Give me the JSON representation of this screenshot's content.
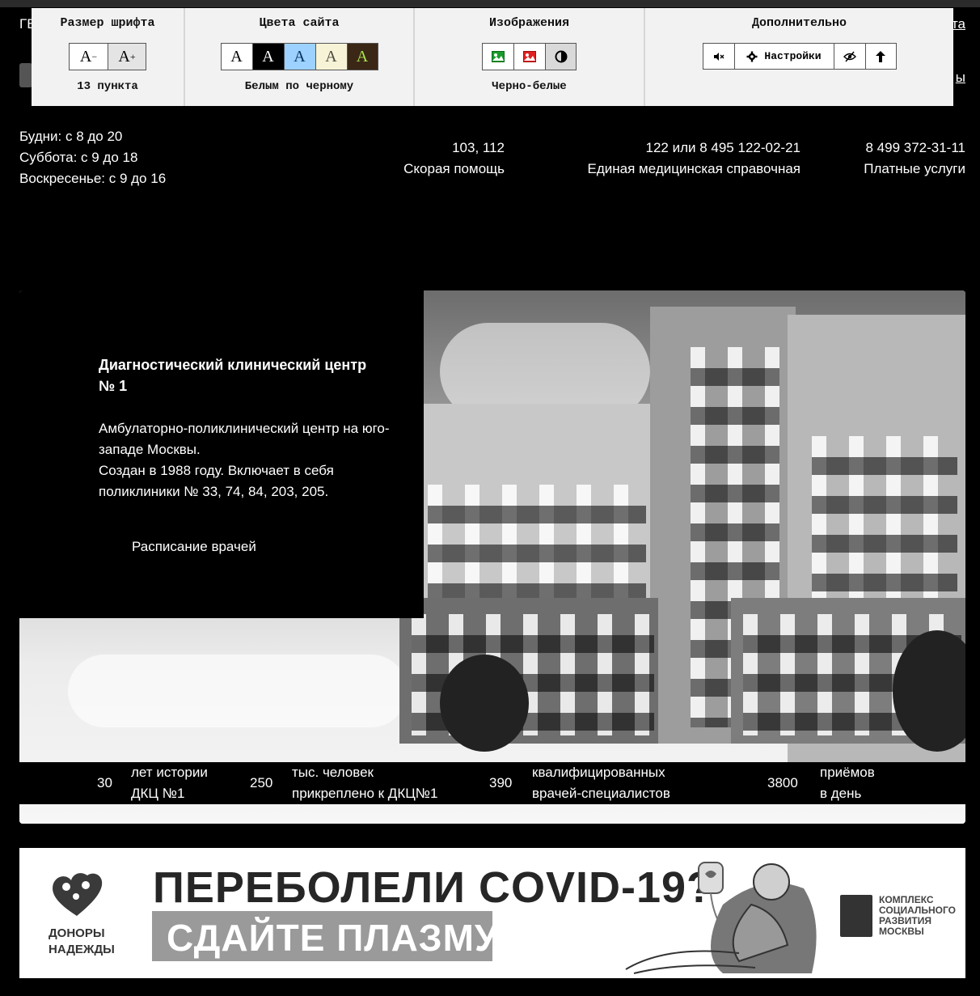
{
  "header": {
    "left_fragment": "ГБ",
    "right_fragment": "та",
    "right_fragment_2": "ы"
  },
  "a11y_panel": {
    "font_size": {
      "title": "Размер шрифта",
      "decrease_label": "A",
      "decrease_sup": "−",
      "increase_label": "A",
      "increase_sup": "+",
      "status": "13 пункта"
    },
    "colors": {
      "title": "Цвета сайта",
      "options": [
        {
          "label": "A",
          "bg": "#ffffff",
          "fg": "#000000"
        },
        {
          "label": "A",
          "bg": "#000000",
          "fg": "#ffffff"
        },
        {
          "label": "A",
          "bg": "#9dd1ff",
          "fg": "#063462"
        },
        {
          "label": "A",
          "bg": "#f7f3d6",
          "fg": "#4d4b43"
        },
        {
          "label": "A",
          "bg": "#3b2716",
          "fg": "#a9e44d"
        }
      ],
      "status": "Белым по черному"
    },
    "images": {
      "title": "Изображения",
      "status": "Черно-белые"
    },
    "extra": {
      "title": "Дополнительно",
      "settings_label": "Настройки"
    }
  },
  "hours": {
    "weekdays": "Будни: с 8 до 20",
    "saturday": "Суббота: с 9 до 18",
    "sunday": "Воскресенье: с 9 до 16"
  },
  "phones": [
    {
      "number": "103, 112",
      "label": "Скорая помощь"
    },
    {
      "number": "122 или 8 495 122-02-21",
      "label": "Единая медицинская справочная"
    },
    {
      "number": "8 499 372-31-11",
      "label": "Платные услуги"
    }
  ],
  "hero": {
    "title": "Диагностический клинический центр № 1",
    "desc_line1": "Амбулаторно-поликлинический центр на юго-западе Москвы.",
    "desc_line2": "Создан в 1988 году. Включает в себя поликлиники № 33, 74, 84, 203, 205.",
    "schedule_link": "Расписание врачей"
  },
  "stats": [
    {
      "num": "30",
      "line1": "лет истории",
      "line2": "ДКЦ №1"
    },
    {
      "num": "250",
      "line1": "тыс. человек",
      "line2": "прикреплено к ДКЦ№1"
    },
    {
      "num": "390",
      "line1": "квалифицированных",
      "line2": "врачей-специалистов"
    },
    {
      "num": "3800",
      "line1": "приёмов",
      "line2": "в день"
    }
  ],
  "banner": {
    "donor_line1": "ДОНОРЫ",
    "donor_line2": "НАДЕЖДЫ",
    "headline": "ПЕРЕБОЛЕЛИ COVID-19?",
    "subheadline": "СДАЙТЕ ПЛАЗМУ",
    "partner_line1": "КОМПЛЕКС",
    "partner_line2": "СОЦИАЛЬНОГО",
    "partner_line3": "РАЗВИТИЯ",
    "partner_line4": "МОСКВЫ"
  }
}
